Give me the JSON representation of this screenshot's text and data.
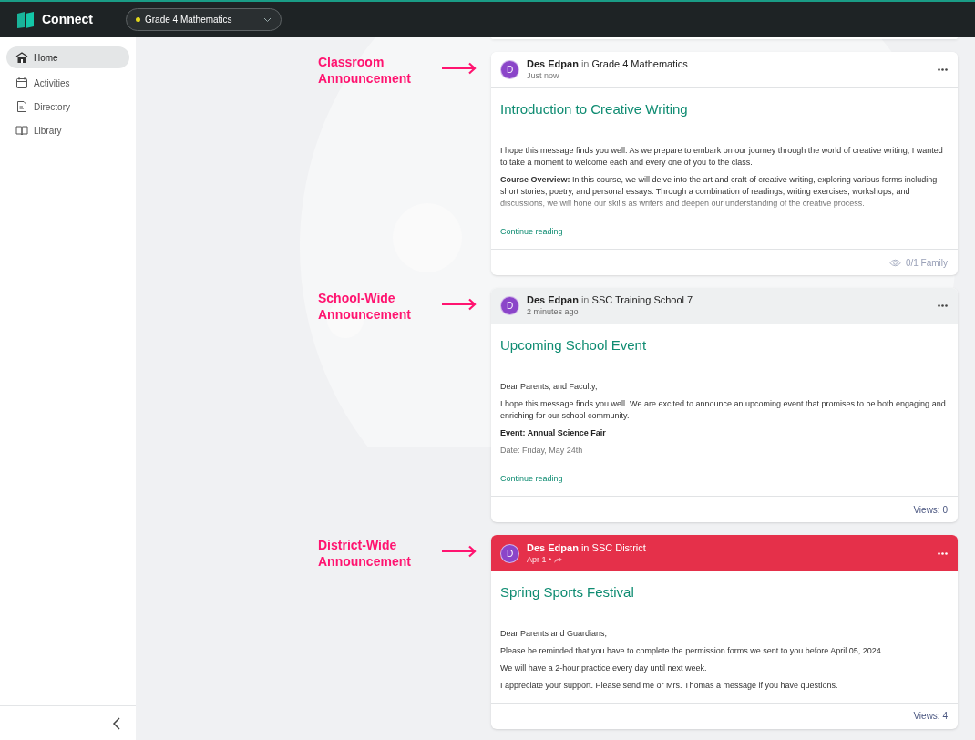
{
  "app": {
    "name": "Connect"
  },
  "class_selector": {
    "label": "Grade 4 Mathematics",
    "color": "#e3d81c"
  },
  "sidebar": {
    "items": [
      {
        "label": "Home",
        "selected": true
      },
      {
        "label": "Activities",
        "selected": false
      },
      {
        "label": "Directory",
        "selected": false
      },
      {
        "label": "Library",
        "selected": false
      }
    ]
  },
  "posts": [
    {
      "annotation": "Classroom Announcement",
      "kind": "classroom",
      "author": "Des Edpan",
      "connector": "in",
      "group": "Grade 4 Mathematics",
      "avatar": "D",
      "time": "Just now",
      "title": "Introduction to Creative Writing",
      "faded": true,
      "paragraphs": [
        {
          "kind": "plain",
          "text": "I hope this message finds you well. As we prepare to embark on our journey through the world of creative writing, I wanted to take a moment to welcome each and every one of you to the class."
        },
        {
          "kind": "plain",
          "text": "**Course Overview:** In this course, we will delve into the art and craft of creative writing, exploring various forms including short stories, poetry, and personal essays. Through a combination of readings, writing exercises, workshops, and discussions, we will hone our skills as writers and deepen our understanding of the creative process."
        }
      ],
      "continue": "Continue reading",
      "footer": {
        "kind": "seen",
        "text": "0/1 Family"
      }
    },
    {
      "annotation": "School-Wide Announcement",
      "kind": "school",
      "author": "Des Edpan",
      "connector": "in",
      "group": "SSC Training School 7",
      "avatar": "D",
      "time": "2 minutes ago",
      "title": "Upcoming School Event",
      "faded": false,
      "paragraphs": [
        {
          "kind": "plain",
          "text": "Dear Parents, and Faculty,"
        },
        {
          "kind": "plain",
          "text": "I hope this message finds you well. We are excited to announce an upcoming event that promises to be both engaging and enriching for our school community."
        },
        {
          "kind": "bold",
          "text": "Event: Annual Science Fair"
        },
        {
          "kind": "muted",
          "text": "Date: Friday, May 24th"
        }
      ],
      "continue": "Continue reading",
      "footer": {
        "kind": "views",
        "text": "Views: 0"
      }
    },
    {
      "annotation": "District-Wide Announcement",
      "kind": "district",
      "author": "Des Edpan",
      "connector": "in",
      "group": "SSC District",
      "avatar": "D",
      "time": "Apr 1 •",
      "title": "Spring Sports Festival",
      "faded": false,
      "paragraphs": [
        {
          "kind": "plain",
          "text": "Dear Parents and Guardians,"
        },
        {
          "kind": "plain",
          "text": "Please be reminded that you have to complete the permission forms we sent to you before April 05, 2024."
        },
        {
          "kind": "plain",
          "text": "We will have a 2-hour practice every day until next week."
        },
        {
          "kind": "plain",
          "text": "I appreciate your support. Please send me or Mrs. Thomas a message if you have questions."
        }
      ],
      "footer": {
        "kind": "views",
        "text": "Views: 4"
      }
    }
  ]
}
